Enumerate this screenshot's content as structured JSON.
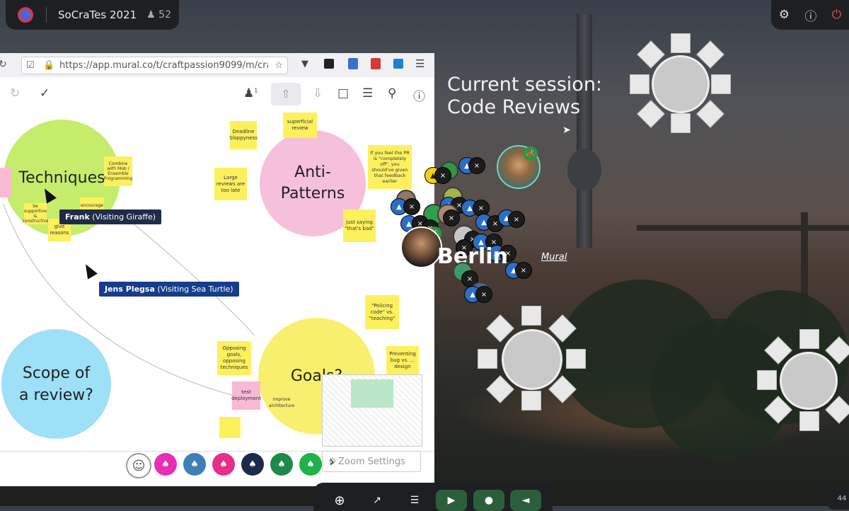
{
  "topbar": {
    "event_title": "SoCraTes 2021",
    "participants": "52",
    "participants_icon": "person-icon"
  },
  "topright": {
    "settings_icon": "gear",
    "help_icon": "?",
    "power_icon": "power"
  },
  "browser": {
    "url": "https://app.mural.co/t/craftpassion9099/m/craftp",
    "collaborators": "1",
    "zoom_settings": "Zoom Settings"
  },
  "board": {
    "circles": {
      "techniques": "Techniques",
      "anti_patterns": "Anti-\nPatterns",
      "scope": "Scope of\na review?",
      "goals": "Goals?"
    },
    "stickies": {
      "superficial": "superficial review",
      "deadline": "Deadline Sloppyness",
      "combine": "Combine with Mob / Ensemble Programming",
      "large": "Large reviews are too late",
      "feel": "If you feel the PR is \"completely off\", you should've given that feedback earlier",
      "just_saying": "just saying \"that's bad\"",
      "supportive": "be supportive & constructive",
      "encourage": "encourage",
      "give_reasons": "give reasons",
      "policing": "\"Policing code\" vs. \"teaching\"",
      "preventing": "Preventing bug vs. ... design",
      "opposing": "Opposing goals, opposing techniques",
      "test": "test deployment",
      "improve": "improve architecture"
    },
    "cursors": {
      "frank_name": "Frank",
      "frank_visit": " (Visiting Giraffe)",
      "jens_name": "Jens Plegsa",
      "jens_visit": " (Visiting Sea Turtle)"
    }
  },
  "session": {
    "line1": "Current session:",
    "line2": "Code Reviews"
  },
  "room": {
    "name": "Berlin",
    "link": "Mural"
  },
  "page_number": "44",
  "colors": {
    "frank_tag": "#1f2b49",
    "jens_tag": "#173d8a",
    "lime": "#c5ec6a",
    "pink": "#f6bfdc",
    "sky": "#9ee0f7",
    "yellow": "#f9ef6e"
  }
}
